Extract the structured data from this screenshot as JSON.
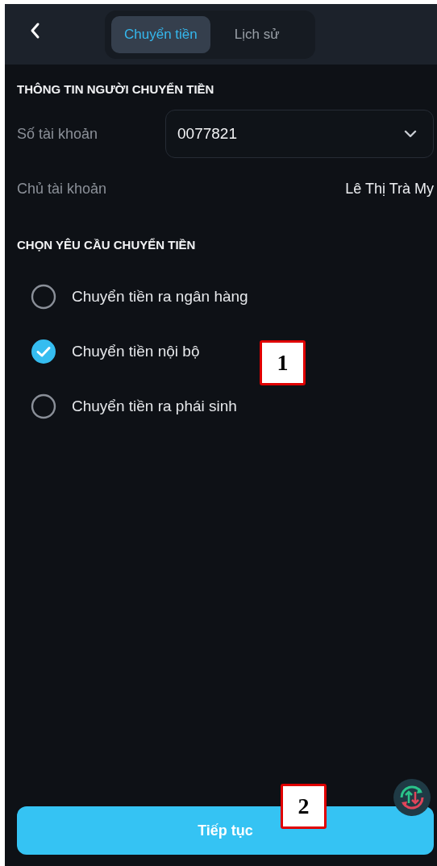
{
  "header": {
    "tabs": [
      {
        "label": "Chuyển tiền",
        "selected": true
      },
      {
        "label": "Lịch sử",
        "selected": false
      }
    ]
  },
  "sender_section": {
    "title": "THÔNG TIN NGƯỜI CHUYỂN TIỀN",
    "account_number": {
      "label": "Số tài khoản",
      "value": "0077821"
    },
    "account_holder": {
      "label": "Chủ tài khoản",
      "value": "Lê Thị Trà My"
    }
  },
  "request_section": {
    "title": "CHỌN YÊU CẦU CHUYỂN TIỀN",
    "options": [
      {
        "label": "Chuyển tiền ra ngân hàng",
        "selected": false
      },
      {
        "label": "Chuyển tiền nội bộ",
        "selected": true
      },
      {
        "label": "Chuyển tiền ra phái sinh",
        "selected": false
      }
    ]
  },
  "continue_button": {
    "label": "Tiếp tục"
  },
  "callouts": [
    {
      "label": "1"
    },
    {
      "label": "2"
    }
  ]
}
